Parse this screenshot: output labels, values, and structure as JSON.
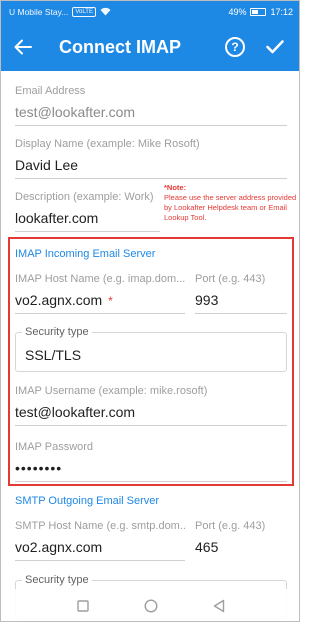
{
  "status_bar": {
    "carrier": "U Mobile Stay...",
    "network_badge": "VoLTE",
    "battery": "49%",
    "time": "17:12"
  },
  "app_bar": {
    "title": "Connect IMAP",
    "help_label": "?",
    "color": "#1e88e5"
  },
  "form": {
    "email": {
      "label": "Email Address",
      "value": "test@lookafter.com"
    },
    "display_name": {
      "label": "Display Name (example: Mike Rosoft)",
      "value": "David Lee"
    },
    "description": {
      "label": "Description (example: Work)",
      "value": "lookafter.com"
    },
    "note": {
      "title": "*Note:",
      "text": "Please use the server address provided by Lookafter Helpdesk team or Email Lookup Tool."
    },
    "incoming": {
      "section_title": "IMAP Incoming Email Server",
      "host": {
        "label": "IMAP Host Name (e.g. imap.dom...)",
        "value": "vo2.agnx.com",
        "marker": "*"
      },
      "port": {
        "label": "Port (e.g. 443)",
        "value": "993"
      },
      "security": {
        "label": "Security type",
        "value": "SSL/TLS"
      },
      "username": {
        "label": "IMAP Username (example: mike.rosoft)",
        "value": "test@lookafter.com"
      },
      "password": {
        "label": "IMAP Password",
        "value": "••••••••"
      }
    },
    "outgoing": {
      "section_title": "SMTP Outgoing Email Server",
      "host": {
        "label": "SMTP Host Name (e.g. smtp.dom...)",
        "value": "vo2.agnx.com"
      },
      "port": {
        "label": "Port (e.g. 443)",
        "value": "465"
      },
      "security": {
        "label": "Security type"
      }
    }
  },
  "colors": {
    "accent": "#1e88e5",
    "highlight": "#e53935"
  }
}
